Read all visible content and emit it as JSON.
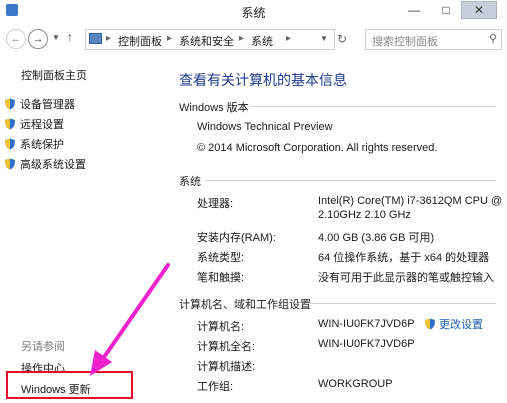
{
  "window": {
    "title": "系统",
    "min": "—",
    "max": "□",
    "close": "✕"
  },
  "nav": {
    "back": "←",
    "forward": "→",
    "up": "↑",
    "refresh": "↻",
    "breadcrumbs": [
      "控制面板",
      "系统和安全",
      "系统"
    ],
    "search_placeholder": "搜索控制面板",
    "search_icon": "search-icon"
  },
  "sidebar": {
    "home": "控制面板主页",
    "items": [
      {
        "label": "设备管理器",
        "icon": "shield-icon"
      },
      {
        "label": "远程设置",
        "icon": "shield-icon"
      },
      {
        "label": "系统保护",
        "icon": "shield-icon"
      },
      {
        "label": "高级系统设置",
        "icon": "shield-icon"
      }
    ],
    "see_also": "另请参阅",
    "action_center": "操作中心",
    "windows_update": "Windows 更新"
  },
  "main": {
    "title": "查看有关计算机的基本信息",
    "edition": {
      "header": "Windows 版本",
      "name": "Windows Technical Preview",
      "copyright": "© 2014 Microsoft Corporation. All rights reserved."
    },
    "system": {
      "header": "系统",
      "processor_label": "处理器:",
      "processor_value_1": "Intel(R) Core(TM) i7-3612QM CPU @",
      "processor_value_2": "2.10GHz   2.10 GHz",
      "ram_label": "安装内存(RAM):",
      "ram_value": "4.00 GB (3.86 GB 可用)",
      "type_label": "系统类型:",
      "type_value": "64 位操作系统，基于 x64 的处理器",
      "pen_label": "笔和触摸:",
      "pen_value": "没有可用于此显示器的笔或触控输入"
    },
    "computer": {
      "header": "计算机名、域和工作组设置",
      "name_label": "计算机名:",
      "name_value": "WIN-IU0FK7JVD6P",
      "fullname_label": "计算机全名:",
      "fullname_value": "WIN-IU0FK7JVD6P",
      "desc_label": "计算机描述:",
      "workgroup_label": "工作组:",
      "workgroup_value": "WORKGROUP",
      "change_settings": "更改设置"
    }
  },
  "annotation": {
    "color": "#ee22cc",
    "box_color": "#e0102a"
  },
  "colors": {
    "title_blue": "#1e3b8a",
    "link_blue": "#1e5fb4"
  }
}
